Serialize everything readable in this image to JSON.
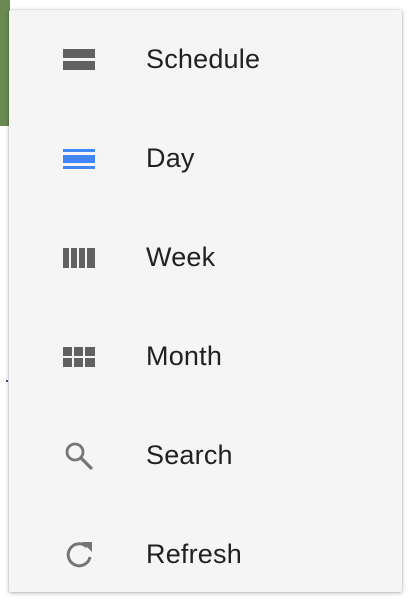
{
  "menu": {
    "items": [
      {
        "label": "Schedule",
        "icon": "schedule-icon",
        "color": "#616161"
      },
      {
        "label": "Day",
        "icon": "day-icon",
        "color": "#4285f4"
      },
      {
        "label": "Week",
        "icon": "week-icon",
        "color": "#616161"
      },
      {
        "label": "Month",
        "icon": "month-icon",
        "color": "#616161"
      },
      {
        "label": "Search",
        "icon": "search-icon",
        "color": "#757575"
      },
      {
        "label": "Refresh",
        "icon": "refresh-icon",
        "color": "#757575"
      }
    ]
  }
}
